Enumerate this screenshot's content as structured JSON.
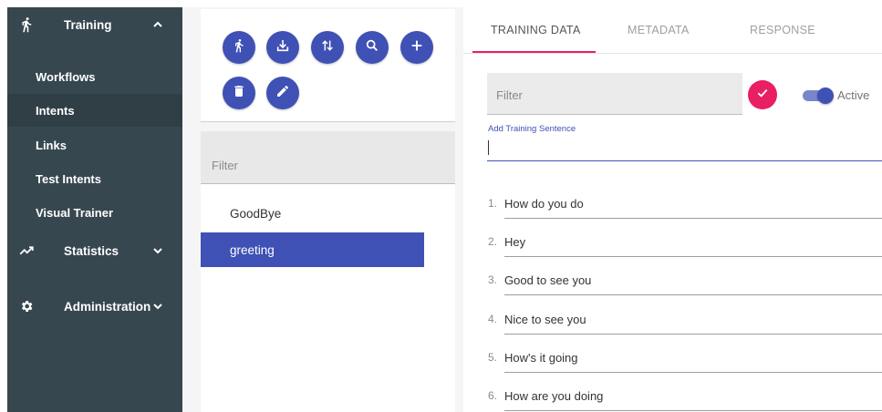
{
  "sidebar": {
    "training": {
      "label": "Training",
      "icon": "walk-icon",
      "chevron": "chevron-up-icon"
    },
    "items": [
      {
        "label": "Workflows"
      },
      {
        "label": "Intents"
      },
      {
        "label": "Links"
      },
      {
        "label": "Test Intents"
      },
      {
        "label": "Visual Trainer"
      }
    ],
    "statistics": {
      "label": "Statistics",
      "icon": "trending-up-icon",
      "chevron": "chevron-down-icon"
    },
    "administration": {
      "label": "Administration",
      "icon": "gear-icon",
      "chevron": "chevron-down-icon"
    },
    "active_item": "Intents"
  },
  "toolbar": {
    "buttons": [
      {
        "icon": "walk-icon"
      },
      {
        "icon": "download-icon"
      },
      {
        "icon": "sort-arrows-icon"
      },
      {
        "icon": "search-icon"
      },
      {
        "icon": "plus-icon"
      },
      {
        "icon": "trash-icon"
      },
      {
        "icon": "pencil-icon"
      }
    ]
  },
  "intents": {
    "filter_placeholder": "Filter",
    "items": [
      {
        "label": "GoodBye"
      },
      {
        "label": "greeting"
      }
    ],
    "selected": "greeting"
  },
  "tabs": [
    {
      "label": "TRAINING DATA"
    },
    {
      "label": "METADATA"
    },
    {
      "label": "RESPONSE"
    }
  ],
  "active_tab": "TRAINING DATA",
  "training": {
    "filter_placeholder": "Filter",
    "active_label": "Active",
    "active": true,
    "add_label": "Add Training Sentence",
    "add_value": "",
    "sentences": [
      {
        "num": "1.",
        "text": "How do you do"
      },
      {
        "num": "2.",
        "text": "Hey"
      },
      {
        "num": "3.",
        "text": "Good to see you"
      },
      {
        "num": "4.",
        "text": "Nice to see you"
      },
      {
        "num": "5.",
        "text": "How's it going"
      },
      {
        "num": "6.",
        "text": "How are you doing"
      }
    ]
  },
  "colors": {
    "sidebar_bg": "#37474f",
    "primary": "#3f51b5",
    "accent": "#e91e63"
  }
}
